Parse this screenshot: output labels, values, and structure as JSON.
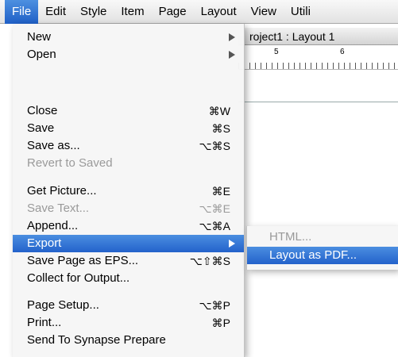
{
  "menubar": {
    "items": [
      "File",
      "Edit",
      "Style",
      "Item",
      "Page",
      "Layout",
      "View",
      "Utili"
    ]
  },
  "document": {
    "title": "roject1 : Layout 1",
    "ruler_numbers": [
      "5",
      "6"
    ]
  },
  "file_menu": {
    "items": [
      {
        "label": "New",
        "shortcut": "",
        "submenu": true,
        "disabled": false
      },
      {
        "label": "Open",
        "shortcut": "",
        "submenu": true,
        "disabled": false
      },
      {
        "label": "Close",
        "shortcut": "⌘W",
        "disabled": false
      },
      {
        "label": "Save",
        "shortcut": "⌘S",
        "disabled": false
      },
      {
        "label": "Save as...",
        "shortcut": "⌥⌘S",
        "disabled": false
      },
      {
        "label": "Revert to Saved",
        "shortcut": "",
        "disabled": true
      },
      {
        "label": "Get Picture...",
        "shortcut": "⌘E",
        "disabled": false
      },
      {
        "label": "Save Text...",
        "shortcut": "⌥⌘E",
        "disabled": true
      },
      {
        "label": "Append...",
        "shortcut": "⌥⌘A",
        "disabled": false
      },
      {
        "label": "Export",
        "shortcut": "",
        "submenu": true,
        "highlighted": true,
        "disabled": false
      },
      {
        "label": "Save Page as EPS...",
        "shortcut": "⌥⇧⌘S",
        "disabled": false
      },
      {
        "label": "Collect for Output...",
        "shortcut": "",
        "disabled": false
      },
      {
        "label": "Page Setup...",
        "shortcut": "⌥⌘P",
        "disabled": false
      },
      {
        "label": "Print...",
        "shortcut": "⌘P",
        "disabled": false
      },
      {
        "label": "Send To Synapse Prepare",
        "shortcut": "",
        "disabled": false
      }
    ]
  },
  "export_submenu": {
    "items": [
      {
        "label": "HTML...",
        "disabled": true
      },
      {
        "label": "Layout as PDF...",
        "highlighted": true
      }
    ]
  },
  "colors": {
    "highlight": "#2a6ad0",
    "disabled_text": "#9a9a9a"
  }
}
